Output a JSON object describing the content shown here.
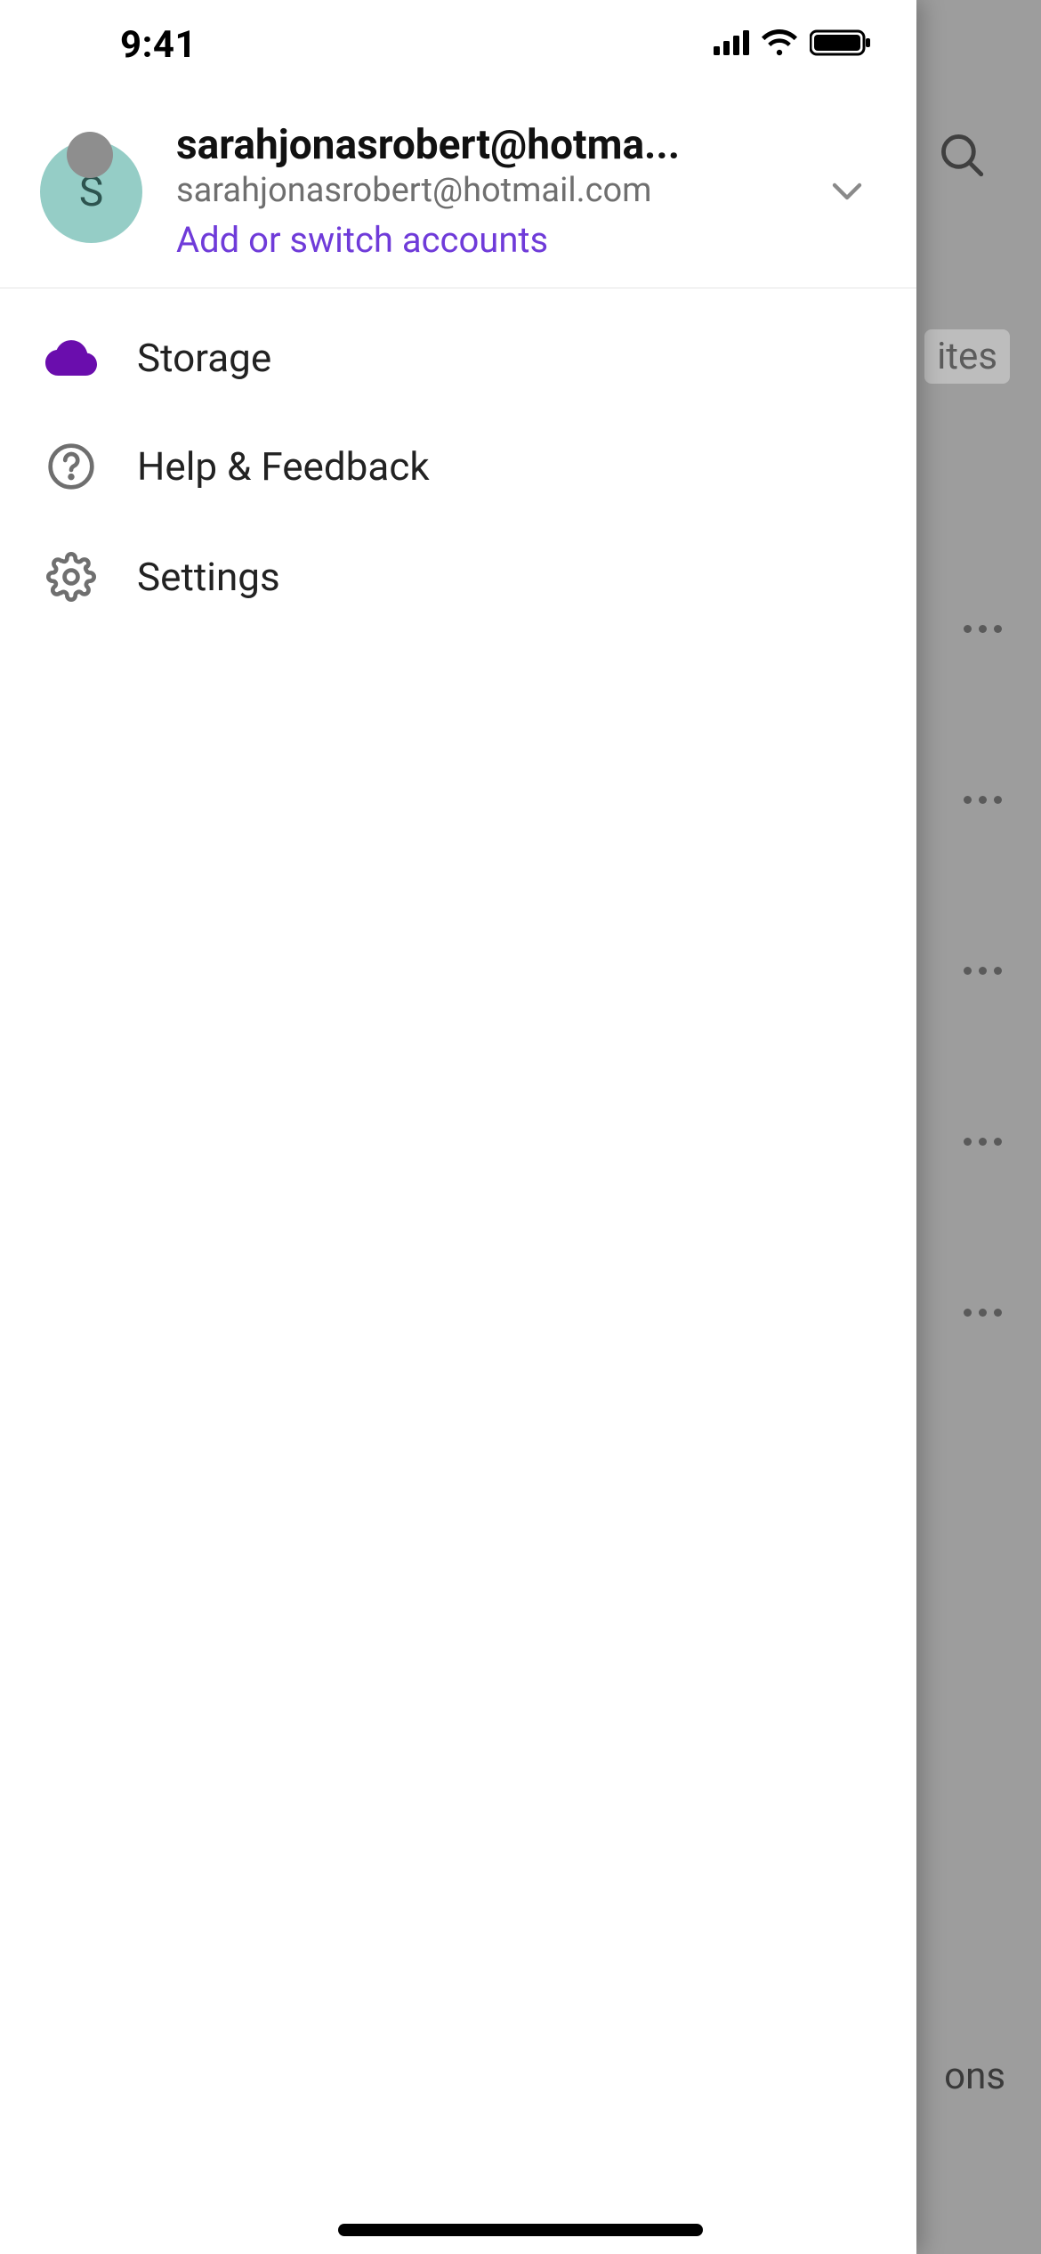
{
  "status_bar": {
    "time": "9:41"
  },
  "account": {
    "avatar_initial": "S",
    "display_name_truncated": "sarahjonasrobert@hotma...",
    "email": "sarahjonasrobert@hotmail.com",
    "switch_label": "Add or switch accounts"
  },
  "menu": {
    "items": [
      {
        "icon": "cloud-icon",
        "label": "Storage"
      },
      {
        "icon": "help-icon",
        "label": "Help & Feedback"
      },
      {
        "icon": "gear-icon",
        "label": "Settings"
      }
    ]
  },
  "backdrop": {
    "visible_tab_fragment": "ites",
    "visible_bottom_fragment": "ons"
  }
}
